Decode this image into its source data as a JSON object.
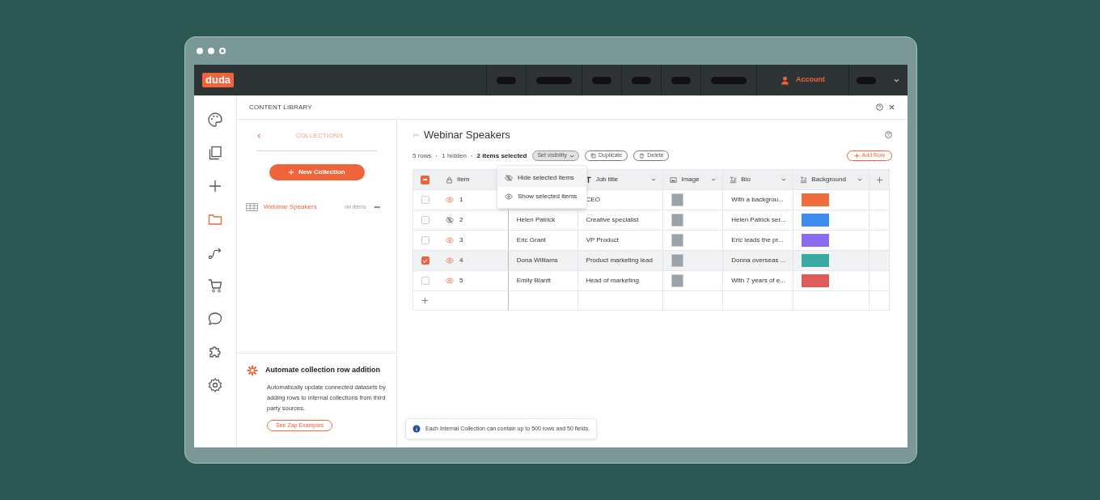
{
  "logo": "duda",
  "top_nav": {
    "account": "Account",
    "placeholders": [
      {
        "kind": "short"
      },
      {
        "kind": "long"
      },
      {
        "kind": "short"
      },
      {
        "kind": "short"
      },
      {
        "kind": "short"
      },
      {
        "kind": "long"
      }
    ]
  },
  "sidebar": {
    "items": [
      {
        "kind": "palette",
        "selected": false
      },
      {
        "kind": "pages",
        "selected": false
      },
      {
        "kind": "add",
        "selected": false
      },
      {
        "kind": "folder",
        "selected": true
      },
      {
        "kind": "flow",
        "selected": false
      },
      {
        "kind": "cart",
        "selected": false
      },
      {
        "kind": "chat",
        "selected": false
      },
      {
        "kind": "puzzle",
        "selected": false
      },
      {
        "kind": "settings",
        "selected": false
      }
    ]
  },
  "panel_title": "CONTENT LIBRARY",
  "collections": {
    "title": "COLLECTIONS",
    "new_button": "New Collection",
    "items": [
      {
        "name": "Webinar Speakers",
        "count": "no items",
        "menu": "•••",
        "selected": true
      }
    ]
  },
  "promo": {
    "title": "Automate collection row addition",
    "text": "Automatically update connected datasets by adding rows to internal collections from third party sources.",
    "button": "See Zap Examples"
  },
  "main": {
    "title": "Webinar Speakers",
    "rows_count": "5 rows",
    "hidden_count": "1 hidden",
    "selected_count": "2 items selected",
    "separators": [
      "·",
      "·"
    ],
    "select_all": {
      "checked": true,
      "partial": true
    },
    "set_visibility": "Set visibility",
    "duplicate": "Duplicate",
    "delete": "Delete",
    "add_row": "Add Row"
  },
  "menu": {
    "items": [
      {
        "kind": "hide",
        "label": "Hide selected items",
        "selected": true
      },
      {
        "kind": "show",
        "label": "Show selected items",
        "selected": false
      }
    ]
  },
  "table": {
    "columns": [
      {
        "kind": "lock",
        "label": "Item"
      },
      {
        "kind": "text",
        "label": "Job title"
      },
      {
        "kind": "image",
        "label": "Image"
      },
      {
        "kind": "rich",
        "label": "Bio"
      },
      {
        "kind": "rich",
        "label": "Background"
      }
    ],
    "rows": [
      {
        "checked": false,
        "visible": true,
        "item": "1",
        "job": "CEO",
        "bio": "With a backgrou...",
        "color": "#f26b3a"
      },
      {
        "checked": false,
        "visible": false,
        "item": "2",
        "name": "Helen Patrick",
        "job": "Creative specialist",
        "bio": "Helen Patrick ser...",
        "color": "#3b8ef0"
      },
      {
        "checked": false,
        "visible": true,
        "item": "3",
        "name": "Eric Grant",
        "job": "VP Product",
        "bio": "Eric leads the pr...",
        "color": "#8a6cf0"
      },
      {
        "checked": true,
        "visible": true,
        "item": "4",
        "name": "Dona Williams",
        "job": "Product marketing lead",
        "bio": "Donna overseas ...",
        "color": "#3aa9a0"
      },
      {
        "checked": false,
        "visible": true,
        "item": "5",
        "name": "Emily Blantt",
        "job": "Head of marketing",
        "bio": "With 7 years of e...",
        "color": "#e25b5b"
      }
    ]
  },
  "notice": "Each Internal Collection can contain up to 500 rows and 50 fields."
}
